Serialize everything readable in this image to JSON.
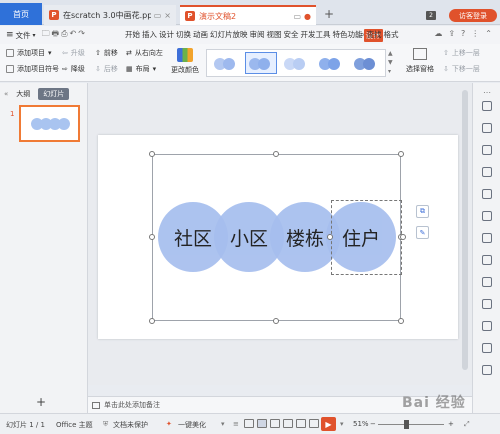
{
  "tabs": {
    "home": "首页",
    "doc1": "在scratch 3.0中画花.pptx",
    "doc2": "演示文稿2",
    "plus": "+",
    "count": "2",
    "guest": "访客登录"
  },
  "menu": {
    "file": "文件",
    "items": [
      "开始",
      "插入",
      "设计",
      "切换",
      "动画",
      "幻灯片放映",
      "审阅",
      "视图",
      "安全",
      "开发工具",
      "特色功能",
      "设计",
      "格式"
    ],
    "active_index": 11,
    "search": "查找"
  },
  "ribbon": {
    "add_item": "添加项目",
    "upgrade": "升级",
    "forward": "前移",
    "rtl": "从右向左",
    "add_bullet": "添加项目符号",
    "downgrade": "降级",
    "backward": "后移",
    "layout": "布局",
    "change_color": "更改颜色",
    "select_pane": "选择窗格",
    "move_up": "上移一层",
    "move_down": "下移一层",
    "style_count": 5,
    "selected_style": 1
  },
  "left_panel": {
    "outline": "大纲",
    "slides": "幻灯片",
    "slide_number": "1",
    "add": "+"
  },
  "slide": {
    "circles": [
      "社区",
      "小区",
      "楼栋",
      "住户"
    ],
    "circle_color": "#a6beee"
  },
  "notes": {
    "placeholder": "单击此处添加备注"
  },
  "status": {
    "slide_counter": "幻灯片 1 / 1",
    "theme": "Office 主题",
    "protect": "文档未保护",
    "beautify": "一键美化",
    "zoom": "51%",
    "minus": "−",
    "plus": "+"
  },
  "watermark": "Bai 经验"
}
